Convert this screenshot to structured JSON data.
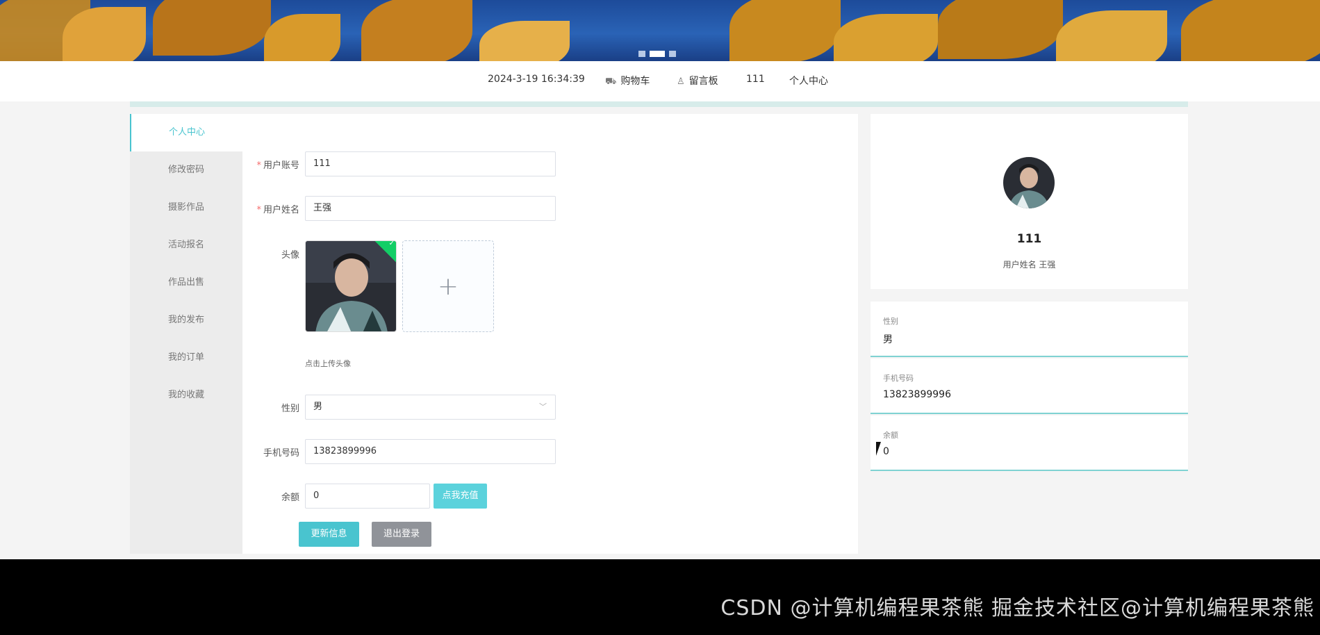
{
  "banner": {
    "slides": 3,
    "active_slide": 2
  },
  "topnav": {
    "datetime": "2024-3-19 16:34:39",
    "cart": "购物车",
    "message_board": "留言板",
    "username": "111",
    "user_center": "个人中心"
  },
  "sidebar": {
    "items": [
      {
        "label": "个人中心",
        "active": true
      },
      {
        "label": "修改密码"
      },
      {
        "label": "摄影作品"
      },
      {
        "label": "活动报名"
      },
      {
        "label": "作品出售"
      },
      {
        "label": "我的发布"
      },
      {
        "label": "我的订单"
      },
      {
        "label": "我的收藏"
      }
    ]
  },
  "form": {
    "account_label": "用户账号",
    "account_value": "111",
    "name_label": "用户姓名",
    "name_value": "王强",
    "avatar_label": "头像",
    "avatar_hint": "点击上传头像",
    "upload_plus": "+",
    "gender_label": "性别",
    "gender_value": "男",
    "phone_label": "手机号码",
    "phone_value": "13823899996",
    "balance_label": "余额",
    "balance_value": "0",
    "recharge_button": "点我充值",
    "update_button": "更新信息",
    "logout_button": "退出登录"
  },
  "profile": {
    "name": "111",
    "subtitle": "用户姓名 王强"
  },
  "info": [
    {
      "label": "性别",
      "value": "男"
    },
    {
      "label": "手机号码",
      "value": "13823899996"
    },
    {
      "label": "余额",
      "value": "0"
    }
  ],
  "watermark": "CSDN @计算机编程果茶熊  掘金技术社区@计算机编程果茶熊",
  "colors": {
    "accent": "#49c4cf",
    "logout": "#909399",
    "required": "#f56c6c"
  }
}
